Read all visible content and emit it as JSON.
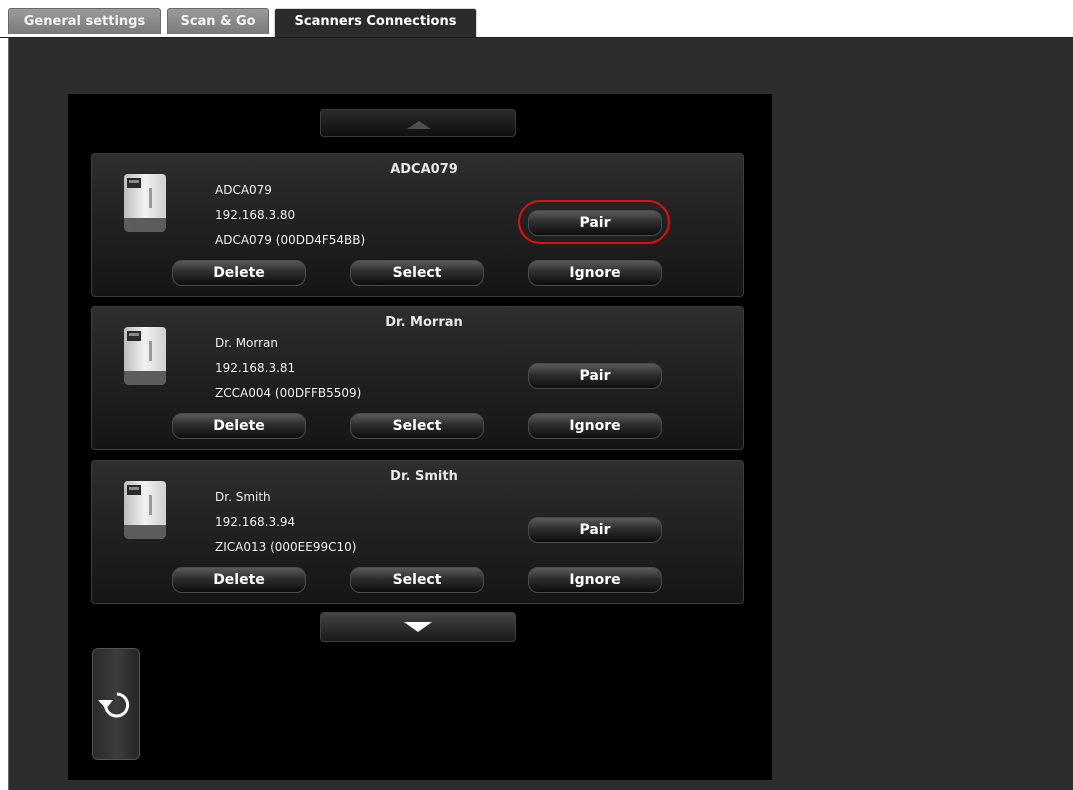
{
  "tabs": [
    {
      "label": "General settings",
      "active": false
    },
    {
      "label": "Scan & Go",
      "active": false
    },
    {
      "label": "Scanners Connections",
      "active": true
    }
  ],
  "scanners": [
    {
      "title": "ADCA079",
      "name": "ADCA079",
      "ip": "192.168.3.80",
      "device": "ADCA079 (00DD4F54BB)",
      "pair_label": "Pair",
      "delete_label": "Delete",
      "select_label": "Select",
      "ignore_label": "Ignore",
      "highlighted": true
    },
    {
      "title": "Dr. Morran",
      "name": "Dr. Morran",
      "ip": "192.168.3.81",
      "device": "ZCCA004 (00DFFB5509)",
      "pair_label": "Pair",
      "delete_label": "Delete",
      "select_label": "Select",
      "ignore_label": "Ignore",
      "highlighted": false
    },
    {
      "title": "Dr. Smith",
      "name": "Dr. Smith",
      "ip": "192.168.3.94",
      "device": "ZICA013 (000EE99C10)",
      "pair_label": "Pair",
      "delete_label": "Delete",
      "select_label": "Select",
      "ignore_label": "Ignore",
      "highlighted": false
    }
  ],
  "icons": {
    "scroll_up": "chevron-up-icon",
    "scroll_down": "chevron-down-icon",
    "refresh": "refresh-icon",
    "scanner": "scanner-device-icon"
  },
  "colors": {
    "highlight": "#e01010",
    "panel": "#000000",
    "workspace": "#2d2d2d"
  }
}
